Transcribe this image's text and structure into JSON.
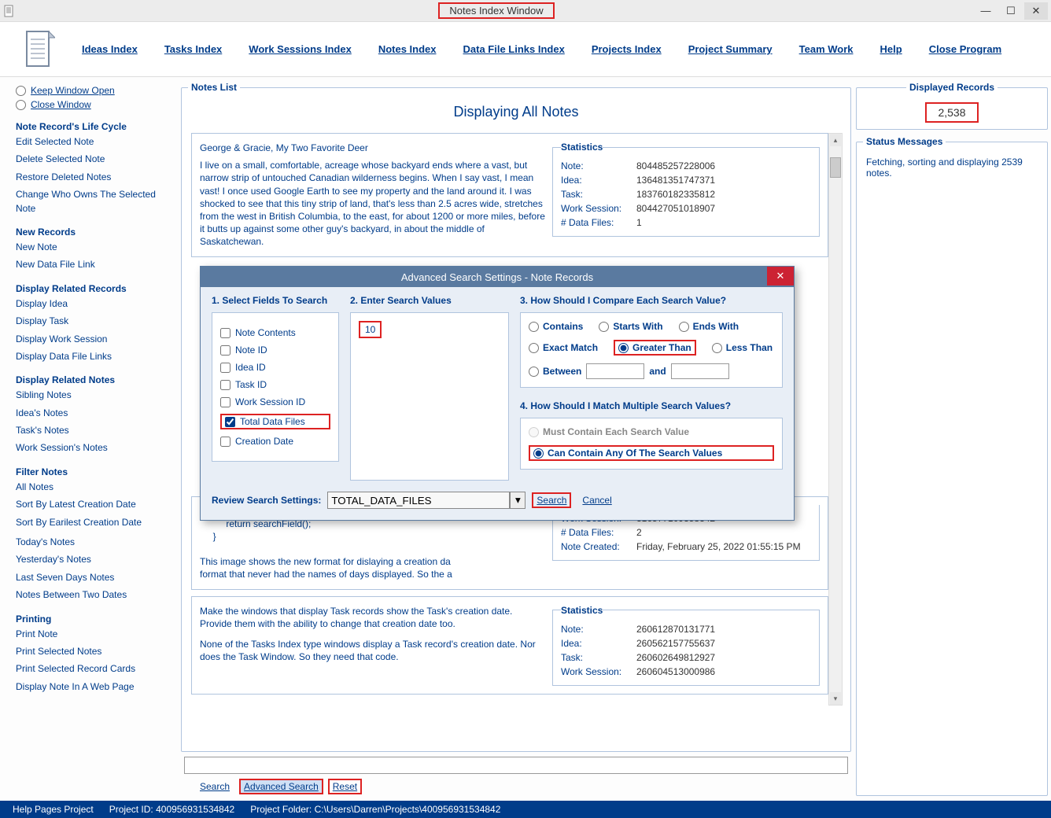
{
  "window": {
    "title": "Notes Index Window"
  },
  "appbar": {
    "links": [
      "Ideas Index",
      "Tasks Index",
      "Work Sessions Index",
      "Notes Index",
      "Data File Links Index",
      "Projects Index",
      "Project Summary",
      "Team Work",
      "Help",
      "Close Program"
    ]
  },
  "sidebar": {
    "keep": "Keep Window Open",
    "close": "Close Window",
    "sections": {
      "lifecycle": {
        "title": "Note Record's Life Cycle",
        "items": [
          "Edit Selected Note",
          "Delete Selected Note",
          "Restore Deleted Notes",
          "Change Who Owns The Selected Note"
        ]
      },
      "newrec": {
        "title": "New Records",
        "items": [
          "New Note",
          "New Data File Link"
        ]
      },
      "disprel": {
        "title": "Display Related Records",
        "items": [
          "Display Idea",
          "Display Task",
          "Display Work Session",
          "Display Data File Links"
        ]
      },
      "dispnotes": {
        "title": "Display Related Notes",
        "items": [
          "Sibling Notes",
          "Idea's Notes",
          "Task's Notes",
          "Work Session's Notes"
        ]
      },
      "filter": {
        "title": "Filter Notes",
        "items": [
          "All Notes",
          "Sort By Latest Creation Date",
          "Sort By Earilest Creation Date",
          "Today's Notes",
          "Yesterday's Notes",
          "Last Seven Days Notes",
          "Notes Between Two Dates"
        ]
      },
      "printing": {
        "title": "Printing",
        "items": [
          "Print Note",
          "Print Selected Notes",
          "Print Selected Record Cards",
          "Display Note In A Web Page"
        ]
      }
    }
  },
  "notes": {
    "legend": "Notes List",
    "heading": "Displaying All Notes",
    "cards": [
      {
        "title": "George & Gracie, My Two Favorite Deer",
        "body": "I live on a small, comfortable, acreage whose backyard ends where a vast, but narrow strip of untouched Canadian wilderness begins. When I say vast, I mean vast! I once used Google Earth to see my property and the land around it. I was shocked to see that this tiny strip of land, that's less than 2.5 acres wide, stretches from the west in British Columbia, to the east, for about 1200 or more miles, before it butts up against some other guy's backyard, in about the middle of Saskatchewan.",
        "stats": {
          "legend": "Statistics",
          "rows": [
            {
              "k": "Note:",
              "v": "804485257228006"
            },
            {
              "k": "Idea:",
              "v": "136481351747371"
            },
            {
              "k": "Task:",
              "v": "183760182335812"
            },
            {
              "k": "Work Session:",
              "v": "804427051018907"
            },
            {
              "k": "# Data Files:",
              "v": "1"
            }
          ]
        }
      },
      {
        "title": "",
        "body": "          fieldValue = TimeStampFormatter.formatDateTimeSetti\n          return searchField();\n     }\n\nThis image shows the new format for dislaying a creation da\nformat that never had the names of days displayed. So the a",
        "stats": {
          "legend": "",
          "rows": [
            {
              "k": "Work Session:",
              "v": "316577109358342"
            },
            {
              "k": "# Data Files:",
              "v": "2"
            },
            {
              "k": "Note Created:",
              "v": "Friday, February 25, 2022   01:55:15 PM"
            }
          ]
        }
      },
      {
        "title": "Make the windows that display Task records show the Task's creation date. Provide them with the ability to change that creation date too.",
        "body": "None of the Tasks Index type windows display a Task record's creation date. Nor does the Task Window. So they need that code.",
        "stats": {
          "legend": "Statistics",
          "rows": [
            {
              "k": "Note:",
              "v": "260612870131771"
            },
            {
              "k": "Idea:",
              "v": "260562157755637"
            },
            {
              "k": "Task:",
              "v": "260602649812927"
            },
            {
              "k": "Work Session:",
              "v": "260604513000986"
            }
          ]
        }
      }
    ]
  },
  "searchbar": {
    "search": "Search",
    "advanced": "Advanced Search",
    "reset": "Reset"
  },
  "right": {
    "disp_legend": "Displayed Records",
    "disp_value": "2,538",
    "status_legend": "Status Messages",
    "status_text": "Fetching, sorting and displaying 2539 notes."
  },
  "footer": {
    "help": "Help Pages Project",
    "pid_label": "Project ID:",
    "pid": "400956931534842",
    "folder_label": "Project Folder:",
    "folder": "C:\\Users\\Darren\\Projects\\400956931534842"
  },
  "dialog": {
    "title": "Advanced Search Settings - Note Records",
    "h1": "1. Select Fields To Search",
    "fields": [
      "Note Contents",
      "Note ID",
      "Idea ID",
      "Task ID",
      "Work Session ID",
      "Total Data Files",
      "Creation Date"
    ],
    "h2": "2. Enter Search Values",
    "search_value": "10",
    "h3": "3. How Should I Compare Each Search Value?",
    "compare": [
      "Contains",
      "Starts With",
      "Ends With",
      "Exact Match",
      "Greater Than",
      "Less Than"
    ],
    "between": "Between",
    "and": "and",
    "h4": "4. How Should I Match Multiple Search Values?",
    "match_each": "Must Contain Each Search Value",
    "match_any": "Can Contain Any Of The Search Values",
    "review_label": "Review Search Settings:",
    "review_value": "TOTAL_DATA_FILES",
    "search_btn": "Search",
    "cancel_btn": "Cancel"
  }
}
